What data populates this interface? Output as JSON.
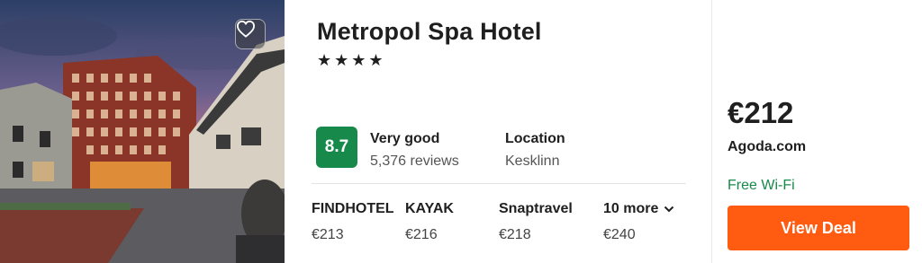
{
  "hotel": {
    "name": "Metropol Spa Hotel",
    "stars_text": "★★★★",
    "star_count": 4
  },
  "rating": {
    "score": "8.7",
    "label": "Very good",
    "reviews": "5,376 reviews"
  },
  "location": {
    "label": "Location",
    "value": "Kesklinn"
  },
  "providers": [
    {
      "name": "FINDHOTEL",
      "price": "€213"
    },
    {
      "name": "KAYAK",
      "price": "€216"
    },
    {
      "name": "Snaptravel",
      "price": "€218"
    }
  ],
  "more": {
    "label": "10 more",
    "price": "€240"
  },
  "deal": {
    "price": "€212",
    "provider": "Agoda.com",
    "feature": "Free Wi-Fi",
    "button_label": "View Deal"
  },
  "colors": {
    "score_bg": "#17894a",
    "feature": "#17894a",
    "button": "#ff5b11"
  },
  "icons": {
    "favorite": "heart-icon",
    "more": "chevron-down-icon"
  }
}
